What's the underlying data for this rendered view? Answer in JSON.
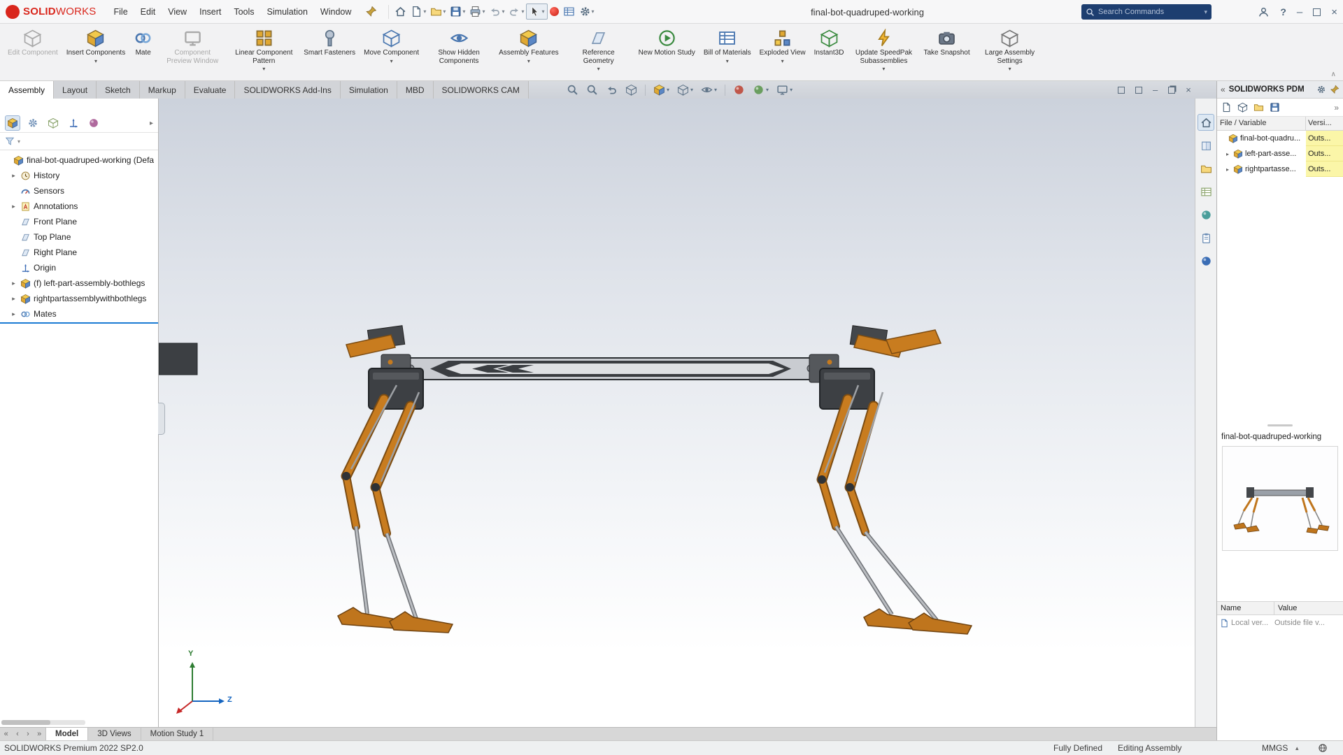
{
  "window": {
    "title": "final-bot-quadruped-working",
    "brand_solid": "SOLID",
    "brand_works": "WORKS",
    "menus": [
      "File",
      "Edit",
      "View",
      "Insert",
      "Tools",
      "Simulation",
      "Window"
    ]
  },
  "search": {
    "placeholder": "Search Commands"
  },
  "ribbon": {
    "buttons": [
      {
        "label": "Edit Component",
        "disabled": true,
        "caret": false
      },
      {
        "label": "Insert Components",
        "disabled": false,
        "caret": true
      },
      {
        "label": "Mate",
        "disabled": false,
        "caret": false
      },
      {
        "label": "Component Preview Window",
        "disabled": true,
        "caret": false
      },
      {
        "label": "Linear Component Pattern",
        "disabled": false,
        "caret": true
      },
      {
        "label": "Smart Fasteners",
        "disabled": false,
        "caret": false
      },
      {
        "label": "Move Component",
        "disabled": false,
        "caret": true
      },
      {
        "label": "Show Hidden Components",
        "disabled": false,
        "caret": false
      },
      {
        "label": "Assembly Features",
        "disabled": false,
        "caret": true
      },
      {
        "label": "Reference Geometry",
        "disabled": false,
        "caret": true
      },
      {
        "label": "New Motion Study",
        "disabled": false,
        "caret": false
      },
      {
        "label": "Bill of Materials",
        "disabled": false,
        "caret": true
      },
      {
        "label": "Exploded View",
        "disabled": false,
        "caret": true
      },
      {
        "label": "Instant3D",
        "disabled": false,
        "caret": false
      },
      {
        "label": "Update SpeedPak Subassemblies",
        "disabled": false,
        "caret": true
      },
      {
        "label": "Take Snapshot",
        "disabled": false,
        "caret": false
      },
      {
        "label": "Large Assembly Settings",
        "disabled": false,
        "caret": true
      }
    ]
  },
  "command_tabs": [
    "Assembly",
    "Layout",
    "Sketch",
    "Markup",
    "Evaluate",
    "SOLIDWORKS Add-Ins",
    "Simulation",
    "MBD",
    "SOLIDWORKS CAM"
  ],
  "feature_tree": {
    "root": "final-bot-quadruped-working (Defa",
    "items": [
      {
        "label": "History"
      },
      {
        "label": "Sensors"
      },
      {
        "label": "Annotations"
      },
      {
        "label": "Front Plane"
      },
      {
        "label": "Top Plane"
      },
      {
        "label": "Right Plane"
      },
      {
        "label": "Origin"
      },
      {
        "label": "(f) left-part-assembly-bothlegs"
      },
      {
        "label": "rightpartassemblywithbothlegs"
      },
      {
        "label": "Mates"
      }
    ]
  },
  "pdm": {
    "title": "SOLIDWORKS PDM",
    "col_file": "File / Variable",
    "col_version": "Versi...",
    "rows": [
      {
        "name": "final-bot-quadru...",
        "value": "Outs..."
      },
      {
        "name": "left-part-asse...",
        "value": "Outs..."
      },
      {
        "name": "rightpartasse...",
        "value": "Outs..."
      }
    ],
    "preview_title": "final-bot-quadruped-working",
    "grid_name": "Name",
    "grid_value": "Value",
    "grid_row_name": "Local ver...",
    "grid_row_value": "Outside file v..."
  },
  "doc_tabs": [
    "Model",
    "3D Views",
    "Motion Study 1"
  ],
  "statusbar": {
    "product": "SOLIDWORKS Premium 2022 SP2.0",
    "state": "Fully Defined",
    "mode": "Editing Assembly",
    "units": "MMGS"
  },
  "triad": {
    "y": "Y",
    "z": "Z"
  },
  "colors": {
    "accent": "#1a7bd4",
    "highlight": "#fbf6a8",
    "robot_orange": "#c0761d",
    "beam_gray": "#c9ccd1",
    "brand_red": "#d9261c"
  }
}
